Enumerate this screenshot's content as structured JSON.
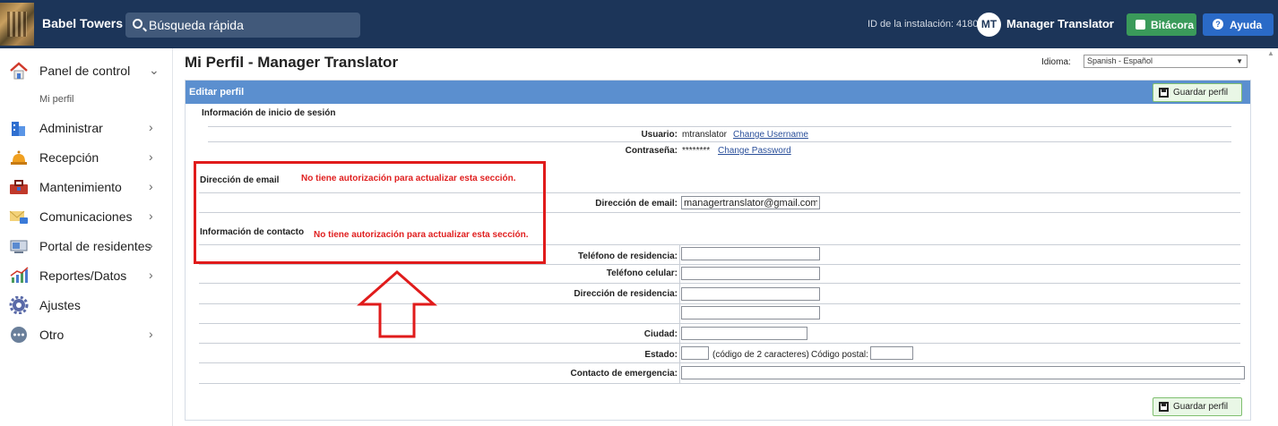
{
  "header": {
    "app_name": "Babel Towers",
    "search_placeholder": "Búsqueda rápida",
    "install_id": "ID de la instalación: 4180",
    "avatar_initials": "MT",
    "user_name": "Manager Translator",
    "bitacora_label": "Bitácora",
    "ayuda_label": "Ayuda"
  },
  "sidebar": {
    "items": [
      {
        "label": "Panel de control",
        "icon": "home-icon"
      },
      {
        "label": "Administrar",
        "icon": "building-icon"
      },
      {
        "label": "Recepción",
        "icon": "bell-icon"
      },
      {
        "label": "Mantenimiento",
        "icon": "toolbox-icon"
      },
      {
        "label": "Comunicaciones",
        "icon": "mail-icon"
      },
      {
        "label": "Portal de residentes",
        "icon": "monitor-icon"
      },
      {
        "label": "Reportes/Datos",
        "icon": "chart-icon"
      },
      {
        "label": "Ajustes",
        "icon": "gear-icon"
      },
      {
        "label": "Otro",
        "icon": "more-icon"
      }
    ],
    "sub_item": "Mi perfil"
  },
  "main": {
    "title": "Mi Perfil - Manager Translator",
    "language_label": "Idioma:",
    "language_value": "Spanish - Español",
    "panel_title": "Editar perfil",
    "save_label": "Guardar perfil",
    "login_section": "Información de inicio de sesión",
    "username_label": "Usuario:",
    "username_value": "mtranslator",
    "change_username": "Change Username",
    "password_label": "Contraseña:",
    "password_value": "********",
    "change_password": "Change Password",
    "email_section": "Dirección de email",
    "no_auth_msg": "No tiene autorización para actualizar esta sección.",
    "email_label": "Dirección de email:",
    "email_value": "managertranslator@gmail.com",
    "contact_section": "Información de contacto",
    "home_phone_label": "Teléfono de residencia:",
    "cell_phone_label": "Teléfono celular:",
    "address_label": "Dirección de residencia:",
    "city_label": "Ciudad:",
    "state_label": "Estado:",
    "state_hint": "(código de 2 caracteres)",
    "zip_label": "Código postal:",
    "emergency_label": "Contacto de emergencia:"
  },
  "colors": {
    "topbar": "#1c3559",
    "panel_header": "#5b8fcf",
    "annotation": "#e01b1b",
    "bitacora": "#3a9a5a",
    "ayuda": "#2a6ac7"
  }
}
